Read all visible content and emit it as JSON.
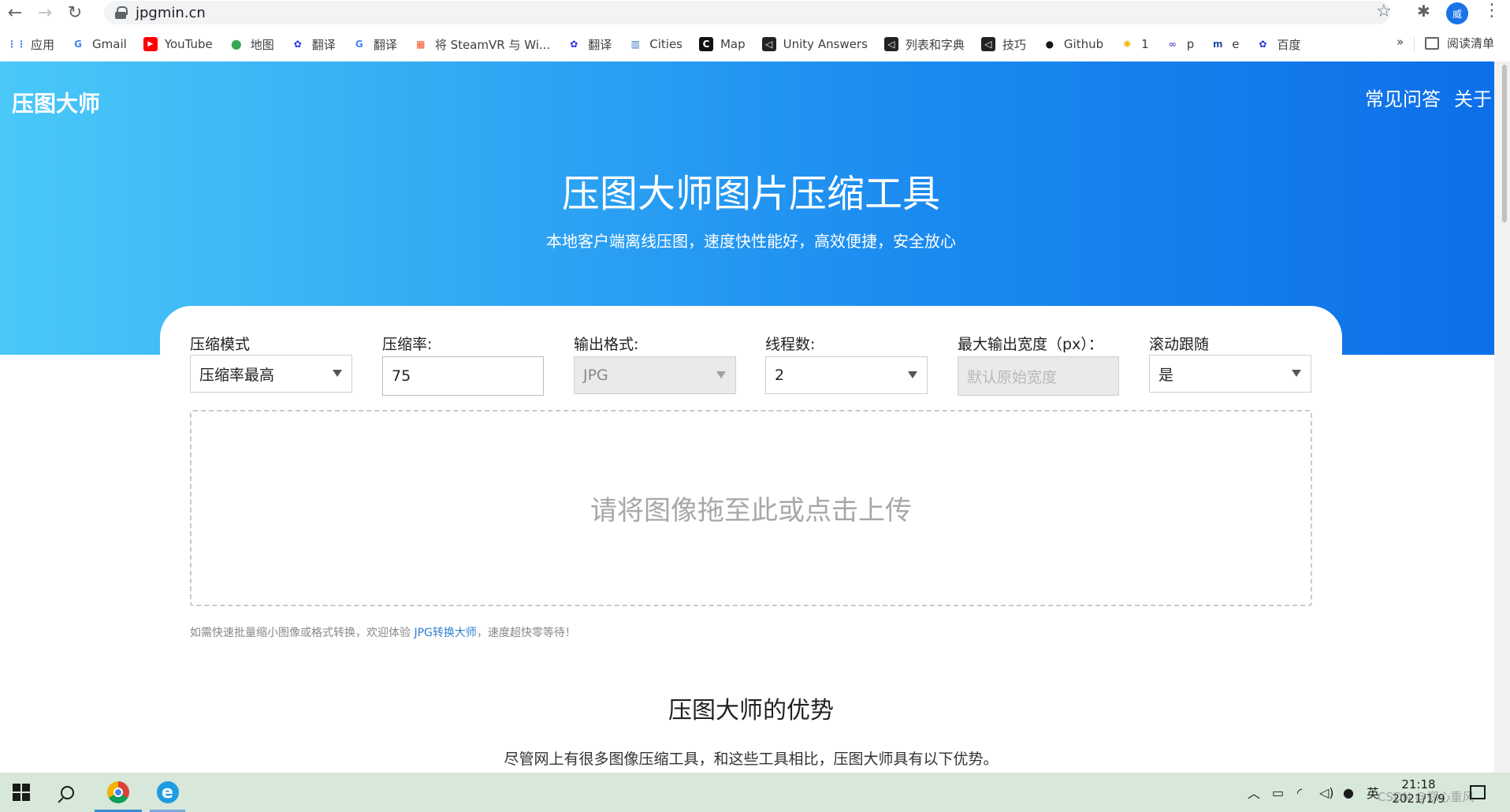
{
  "browser": {
    "url": "jpgmin.cn",
    "profile_initial": "威",
    "bookmarks": [
      {
        "label": "应用",
        "icon": "apps-grid-icon",
        "color": "#4285f4"
      },
      {
        "label": "Gmail",
        "icon": "google-g-icon",
        "color": "#4285f4"
      },
      {
        "label": "YouTube",
        "icon": "youtube-icon",
        "color": "#ff0000"
      },
      {
        "label": "地图",
        "icon": "maps-pin-icon",
        "color": "#34a853"
      },
      {
        "label": "翻译",
        "icon": "baidu-paw-icon",
        "color": "#2932e1"
      },
      {
        "label": "翻译",
        "icon": "google-translate-icon",
        "color": "#4285f4"
      },
      {
        "label": "将 SteamVR 与 Wi...",
        "icon": "windows-icon",
        "color": "#f25022"
      },
      {
        "label": "翻译",
        "icon": "baidu-paw-icon",
        "color": "#2932e1"
      },
      {
        "label": "Cities",
        "icon": "cities-icon",
        "color": "#3b7bbf"
      },
      {
        "label": "Map",
        "icon": "c-logo-icon",
        "color": "#111111"
      },
      {
        "label": "Unity Answers",
        "icon": "unity-icon",
        "color": "#222222"
      },
      {
        "label": "列表和字典",
        "icon": "unity-icon",
        "color": "#222222"
      },
      {
        "label": "技巧",
        "icon": "unity-icon",
        "color": "#222222"
      },
      {
        "label": "Github",
        "icon": "github-icon",
        "color": "#181717"
      },
      {
        "label": "1",
        "icon": "bookmark-colorful-icon",
        "color": "#f4b400"
      },
      {
        "label": "p",
        "icon": "bookmark-link-icon",
        "color": "#6a5acd"
      },
      {
        "label": "e",
        "icon": "bookmark-m-icon",
        "color": "#1e50a0"
      },
      {
        "label": "百度",
        "icon": "baidu-paw-icon",
        "color": "#2932e1"
      }
    ],
    "more_label": "»",
    "reading_list": "阅读清单"
  },
  "site": {
    "logo": "压图大师",
    "nav": [
      "常见问答",
      "关于"
    ],
    "hero_title": "压图大师图片压缩工具",
    "hero_subtitle": "本地客户端离线压图，速度快性能好，高效便捷，安全放心",
    "colors": {
      "hero_start": "#4ac8f8",
      "hero_end": "#0d6fe8"
    }
  },
  "form": {
    "mode": {
      "label": "压缩模式",
      "value": "压缩率最高"
    },
    "rate": {
      "label": "压缩率:",
      "value": "75"
    },
    "format": {
      "label": "输出格式:",
      "value": "JPG"
    },
    "threads": {
      "label": "线程数:",
      "value": "2"
    },
    "max_width": {
      "label": "最大输出宽度（px）：",
      "placeholder": "默认原始宽度"
    },
    "scroll_follow": {
      "label": "滚动跟随",
      "value": "是"
    }
  },
  "upload": {
    "prompt": "请将图像拖至此或点击上传",
    "hint_prefix": "如需快速批量缩小图像或格式转换，欢迎体验 ",
    "hint_link": "JPG转换大师",
    "hint_suffix": "，速度超快零等待！"
  },
  "section": {
    "title": "压图大师的优势",
    "text": "尽管网上有很多图像压缩工具，和这些工具相比，压图大师具有以下优势。"
  },
  "taskbar": {
    "ime": "英",
    "time": "21:18",
    "date": "2021/1/9",
    "watermark": "CSDN @郑心重风"
  }
}
